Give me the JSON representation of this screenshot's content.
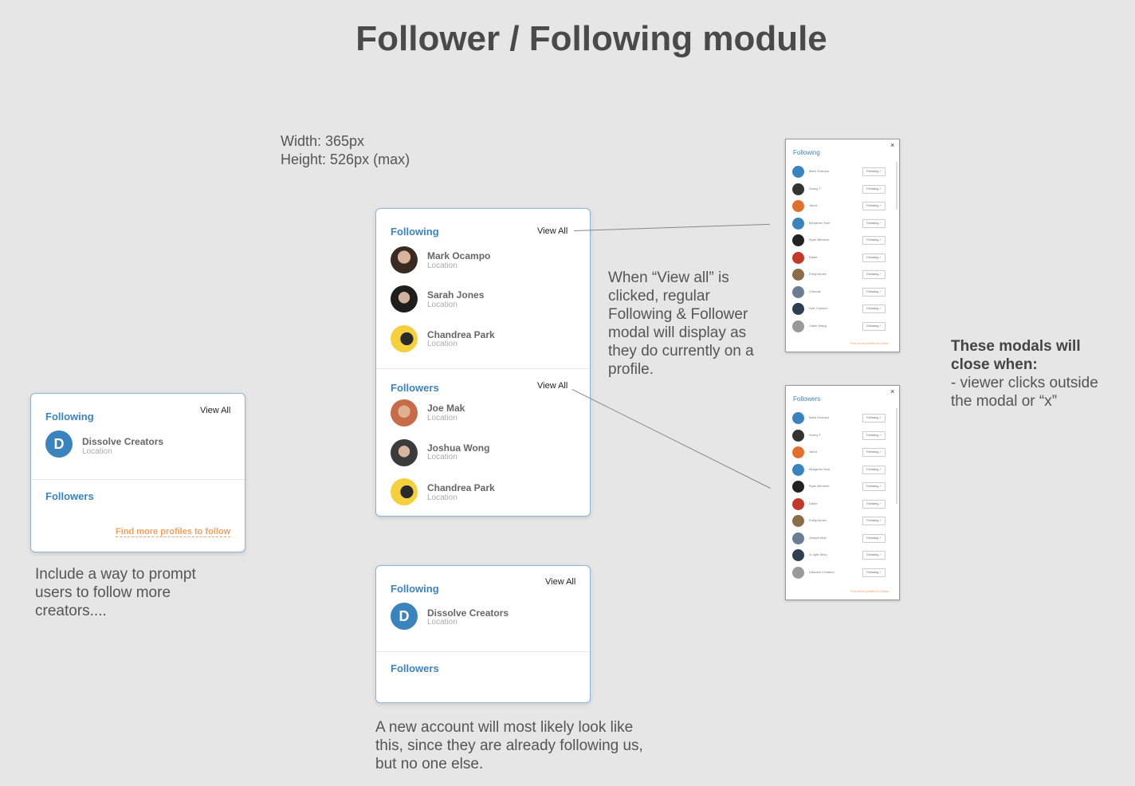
{
  "title": "Follower / Following module",
  "spec": {
    "width": "Width: 365px",
    "height": "Height: 526px (max)"
  },
  "small_card": {
    "following_title": "Following",
    "view_all": "View All",
    "person": {
      "name": "Dissolve Creators",
      "location": "Location",
      "logo_letter": "D"
    },
    "followers_title": "Followers",
    "find_more": "Find more profiles to follow"
  },
  "small_note": "Include a way to prompt users to follow more creators....",
  "main_card": {
    "following_title": "Following",
    "following_view_all": "View All",
    "following": [
      {
        "name": "Mark Ocampo",
        "location": "Location"
      },
      {
        "name": "Sarah Jones",
        "location": "Location"
      },
      {
        "name": "Chandrea Park",
        "location": "Location"
      }
    ],
    "followers_title": "Followers",
    "followers_view_all": "View All",
    "followers": [
      {
        "name": "Joe Mak",
        "location": "Location"
      },
      {
        "name": "Joshua Wong",
        "location": "Location"
      },
      {
        "name": "Chandrea Park",
        "location": "Location"
      }
    ]
  },
  "new_card": {
    "following_title": "Following",
    "view_all": "View All",
    "person": {
      "name": "Dissolve Creators",
      "location": "Location",
      "logo_letter": "D"
    },
    "followers_title": "Followers"
  },
  "new_note": "A new account will most likely look like this, since they are already following us, but no one else.",
  "view_all_note": "When “View all” is clicked, regular Following & Follower modal will display as they do currently on a profile.",
  "close_note": {
    "heading": "These modals will close when:",
    "body": "- viewer clicks outside the modal or “x”"
  },
  "modal_following": {
    "title": "Following",
    "close": "×",
    "button_label": "Following ✓",
    "rows": [
      "Mark Ocampo",
      "Sunny T",
      "Jared",
      "Benjamin Hunt",
      "Ryan Behrens",
      "Diane",
      "Emily Axnes",
      "Chinook",
      "Kyle Coulson",
      "Caleb Wang"
    ],
    "find_more": "Find more profiles to follow"
  },
  "modal_followers": {
    "title": "Followers",
    "close": "×",
    "button_label": "Following ✓",
    "rows": [
      "Mark Ocampo",
      "Sunny T",
      "Jared",
      "Benjamin Hunt",
      "Ryan Behrens",
      "Diane",
      "Emily Axnes",
      "Joseph Mak",
      "A Light Story",
      "Dissolve Creators"
    ],
    "find_more": "Find more profiles to follow"
  },
  "colors": {
    "accent": "#3b83bd",
    "orange": "#f0a060"
  }
}
